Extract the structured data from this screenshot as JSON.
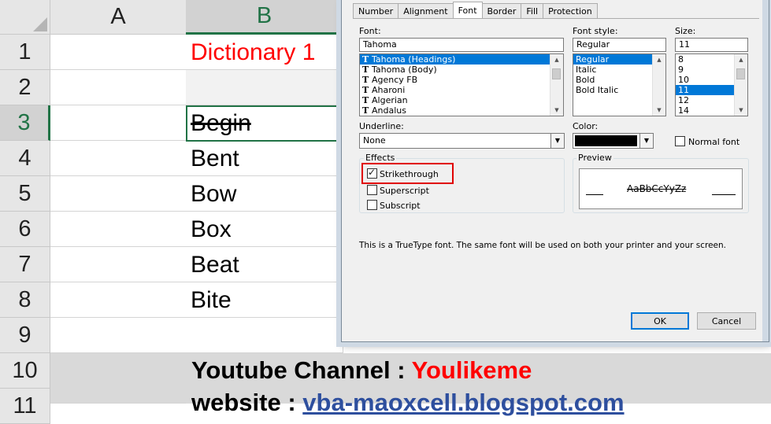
{
  "sheet": {
    "columns": [
      "A",
      "B"
    ],
    "rows": [
      "1",
      "2",
      "3",
      "4",
      "5",
      "6",
      "7",
      "8",
      "9",
      "10",
      "11"
    ],
    "b1": "Dictionary 1",
    "words": [
      "Begin",
      "Bent",
      "Bow",
      "Box",
      "Beat",
      "Bite"
    ],
    "footer1_label": "Youtube Channel",
    "footer1_sep": " : ",
    "footer1_value": "Youlikeme",
    "footer2_label": "website",
    "footer2_sep": " : ",
    "footer2_value": "vba-maoxcell.blogspot.com"
  },
  "dialog": {
    "tabs": [
      "Number",
      "Alignment",
      "Font",
      "Border",
      "Fill",
      "Protection"
    ],
    "active_tab": "Font",
    "font_label": "Font:",
    "font_value": "Tahoma",
    "font_list": [
      "Tahoma (Headings)",
      "Tahoma (Body)",
      "Agency FB",
      "Aharoni",
      "Algerian",
      "Andalus"
    ],
    "style_label": "Font style:",
    "style_value": "Regular",
    "style_list": [
      "Regular",
      "Italic",
      "Bold",
      "Bold Italic"
    ],
    "size_label": "Size:",
    "size_value": "11",
    "size_list": [
      "8",
      "9",
      "10",
      "11",
      "12",
      "14"
    ],
    "underline_label": "Underline:",
    "underline_value": "None",
    "color_label": "Color:",
    "color_value": "#000000",
    "normal_font_label": "Normal font",
    "effects_label": "Effects",
    "strikethrough_label": "Strikethrough",
    "superscript_label": "Superscript",
    "subscript_label": "Subscript",
    "preview_label": "Preview",
    "preview_text": "AaBbCcYyZz",
    "info_text": "This is a TrueType font.  The same font will be used on both your printer and your screen.",
    "ok_label": "OK",
    "cancel_label": "Cancel"
  },
  "colors": {
    "accent_green": "#217346",
    "red": "#ff0000",
    "selection_blue": "#0078d7",
    "highlight_red": "#e00000"
  }
}
